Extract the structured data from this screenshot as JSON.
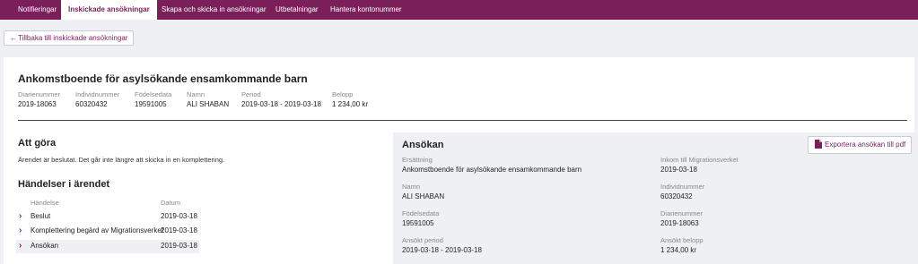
{
  "nav": {
    "tabs": [
      {
        "label": "Notifieringar"
      },
      {
        "label": "Inskickade ansökningar"
      },
      {
        "label": "Skapa och skicka in ansökningar"
      },
      {
        "label": "Utbetalningar"
      },
      {
        "label": "Hantera kontonummer"
      }
    ],
    "active_index": 1,
    "colors": {
      "brand": "#7a1f5a",
      "background": "#eef0f3"
    }
  },
  "back_button": {
    "label": "Tillbaka till inskickade ansökningar",
    "icon": "arrow-left-icon"
  },
  "case": {
    "title": "Ankomstboende för asylsökande ensamkommande barn",
    "meta": [
      {
        "label": "Diarienummer",
        "value": "2019-18063"
      },
      {
        "label": "Individnummer",
        "value": "60320432"
      },
      {
        "label": "Födelsedata",
        "value": "19591005"
      },
      {
        "label": "Namn",
        "value": "ALI SHABAN"
      },
      {
        "label": "Period",
        "value": "2019-03-18 - 2019-03-18"
      },
      {
        "label": "Belopp",
        "value": "1 234,00 kr"
      }
    ]
  },
  "todo": {
    "heading": "Att göra",
    "text": "Ärendet är beslutat. Det går inte längre att skicka in en komplettering."
  },
  "events": {
    "heading": "Händelser i ärendet",
    "columns": [
      "Händelse",
      "Datum"
    ],
    "rows": [
      {
        "name": "Beslut",
        "date": "2019-03-18",
        "icon": "chevron-right-icon"
      },
      {
        "name": "Komplettering begärd av Migrationsverket",
        "date": "2019-03-18",
        "icon": "chevron-right-icon"
      },
      {
        "name": "Ansökan",
        "date": "2019-03-18",
        "icon": "chevron-right-icon"
      }
    ]
  },
  "application": {
    "heading": "Ansökan",
    "export_label": "Exportera ansökan till pdf",
    "export_icon": "pdf-icon",
    "fields_left": [
      {
        "label": "Ersättning",
        "value": "Ankomstboende för asylsökande ensamkommande barn"
      },
      {
        "label": "Namn",
        "value": "ALI SHABAN"
      },
      {
        "label": "Födelsedata",
        "value": "19591005"
      },
      {
        "label": "Ansökt period",
        "value": "2019-03-18 - 2019-03-18"
      }
    ],
    "fields_right": [
      {
        "label": "Inkom till Migrationsverket",
        "value": "2019-03-18"
      },
      {
        "label": "Individnummer",
        "value": "60320432"
      },
      {
        "label": "Diarienummer",
        "value": "2019-18063"
      },
      {
        "label": "Ansökt belopp",
        "value": "1 234,00 kr"
      }
    ]
  }
}
